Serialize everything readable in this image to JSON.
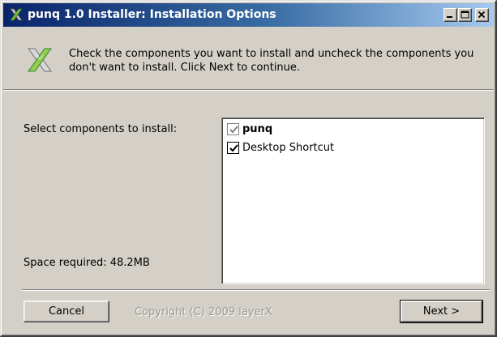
{
  "window": {
    "title": "punq 1.0 Installer: Installation Options",
    "title_gradient_start": "#0a246a",
    "title_gradient_end": "#a6caf0",
    "caption_buttons": [
      "minimize-icon",
      "maximize-icon",
      "close-icon"
    ]
  },
  "header": {
    "logo_icon": "x-logo-icon",
    "instruction": "Check the components you want to install and uncheck the components you don't want to install. Click Next to continue."
  },
  "components": {
    "select_label": "Select components to install:",
    "space_required": "Space required: 48.2MB",
    "items": [
      {
        "label": "punq",
        "checked": true,
        "disabled": true,
        "bold": true
      },
      {
        "label": "Desktop Shortcut",
        "checked": true,
        "disabled": false,
        "bold": false
      }
    ]
  },
  "footer": {
    "cancel_label": "Cancel",
    "copyright": "Copyright (C) 2009 layerX",
    "next_label": "Next >"
  }
}
